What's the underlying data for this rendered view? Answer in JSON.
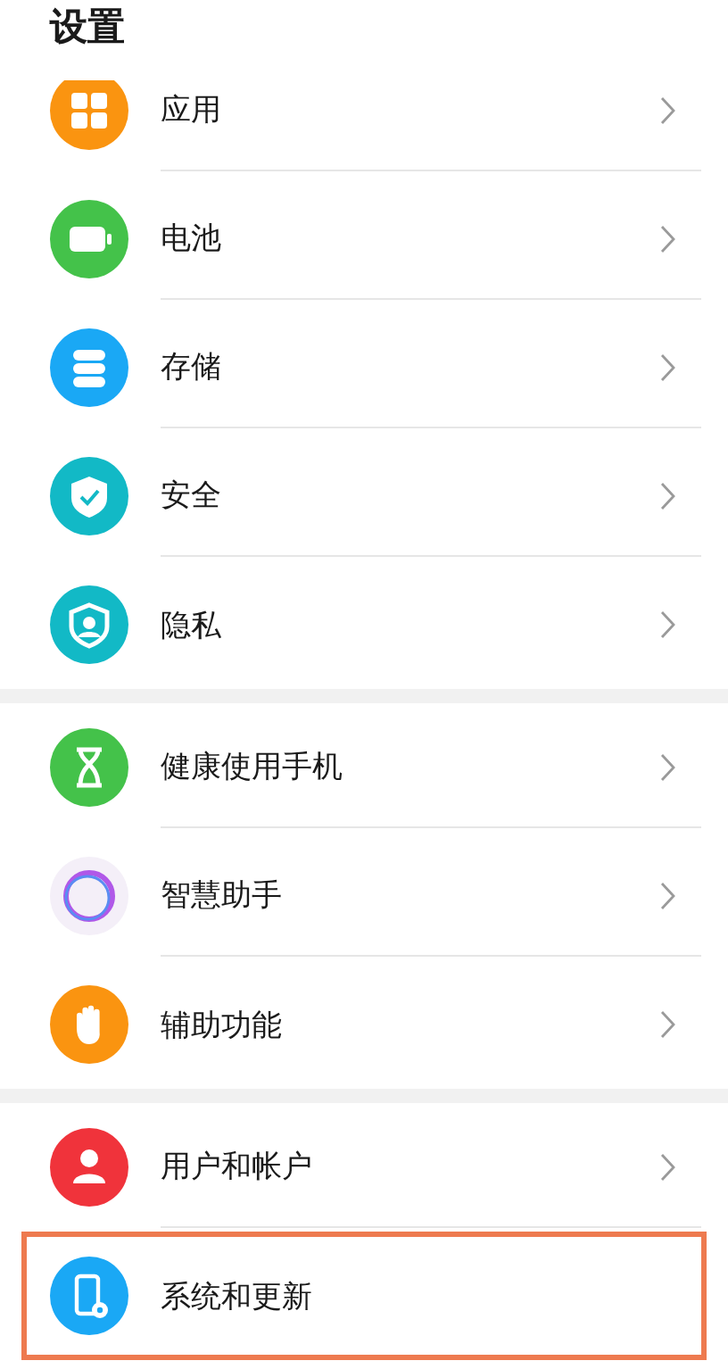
{
  "title": "设置",
  "groups": [
    {
      "items": [
        {
          "label": "应用",
          "color": "#fa9410",
          "chevron": true,
          "highlighted": false
        },
        {
          "label": "电池",
          "color": "#44c24a",
          "chevron": true,
          "highlighted": false
        },
        {
          "label": "存储",
          "color": "#1aa8f5",
          "chevron": true,
          "highlighted": false
        },
        {
          "label": "安全",
          "color": "#12b9c6",
          "chevron": true,
          "highlighted": false
        },
        {
          "label": "隐私",
          "color": "#12b9c6",
          "chevron": true,
          "highlighted": false
        }
      ]
    },
    {
      "items": [
        {
          "label": "健康使用手机",
          "color": "#44c24a",
          "chevron": true,
          "highlighted": false
        },
        {
          "label": "智慧助手",
          "color": "#f4eff8",
          "chevron": true,
          "highlighted": false
        },
        {
          "label": "辅助功能",
          "color": "#fa9410",
          "chevron": true,
          "highlighted": false
        }
      ]
    },
    {
      "items": [
        {
          "label": "用户和帐户",
          "color": "#f0333b",
          "chevron": true,
          "highlighted": false
        },
        {
          "label": "系统和更新",
          "color": "#1aa8f5",
          "chevron": false,
          "highlighted": true
        }
      ]
    }
  ]
}
